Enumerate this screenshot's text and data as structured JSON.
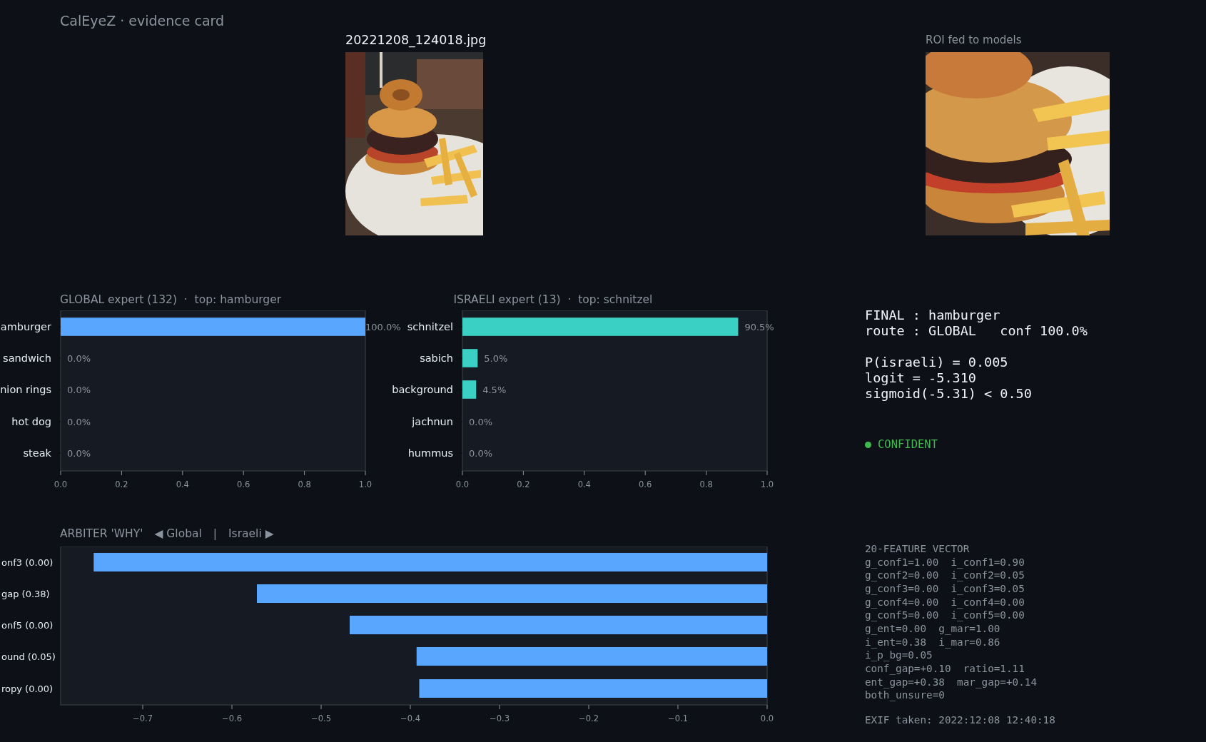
{
  "title": "CalEyeZ · evidence card",
  "photo": {
    "filename": "20221208_124018.jpg"
  },
  "roi": {
    "caption": "ROI fed to models"
  },
  "global_expert": {
    "title": "GLOBAL expert (132)  ·  top: hamburger",
    "chart_data": {
      "type": "bar",
      "orientation": "horizontal",
      "categories": [
        "amburger",
        "sandwich",
        "nion rings",
        "hot dog",
        "steak"
      ],
      "series": [
        {
          "color": "#58a6ff",
          "values": [
            1.0,
            0,
            0,
            0,
            0
          ]
        }
      ],
      "xlim": [
        0,
        1
      ],
      "xticks": [
        {
          "value": 0,
          "label": "0.0"
        },
        {
          "value": 0.2,
          "label": "0.2"
        },
        {
          "value": 0.4,
          "label": "0.4"
        },
        {
          "value": 0.6,
          "label": "0.6"
        },
        {
          "value": 0.8,
          "label": "0.8"
        },
        {
          "value": 1,
          "label": "1.0"
        }
      ],
      "value_labels": [
        "100.0%",
        "0.0%",
        "0.0%",
        "0.0%",
        "0.0%"
      ]
    }
  },
  "israeli_expert": {
    "title": "ISRAELI expert (13)  ·  top: schnitzel",
    "chart_data": {
      "type": "bar",
      "orientation": "horizontal",
      "categories": [
        "schnitzel",
        "sabich",
        "background",
        "jachnun",
        "hummus"
      ],
      "series": [
        {
          "color": "#3bd0c4",
          "values": [
            0.905,
            0.05,
            0.045,
            0,
            0
          ]
        }
      ],
      "xlim": [
        0,
        1
      ],
      "xticks": [
        {
          "value": 0,
          "label": "0.0"
        },
        {
          "value": 0.2,
          "label": "0.2"
        },
        {
          "value": 0.4,
          "label": "0.4"
        },
        {
          "value": 0.6,
          "label": "0.6"
        },
        {
          "value": 0.8,
          "label": "0.8"
        },
        {
          "value": 1,
          "label": "1.0"
        }
      ],
      "value_labels": [
        "90.5%",
        "5.0%",
        "4.5%",
        "0.0%",
        "0.0%"
      ]
    }
  },
  "arbiter": {
    "title": "ARBITER 'WHY'",
    "legend": [
      "◀ Global",
      "|",
      "Israeli ▶"
    ],
    "chart_data": {
      "type": "bar",
      "orientation": "horizontal",
      "categories": [
        "onf3 (0.00)",
        "gap (0.38)",
        "onf5 (0.00)",
        "ound (0.05)",
        "ropy (0.00)"
      ],
      "series": [
        {
          "color": "#58a6ff",
          "values": [
            -0.755,
            -0.572,
            -0.468,
            -0.393,
            -0.39
          ]
        }
      ],
      "xlim": [
        -0.792,
        0
      ],
      "xticks": [
        {
          "value": -0.7,
          "label": "−0.7"
        },
        {
          "value": -0.6,
          "label": "−0.6"
        },
        {
          "value": -0.5,
          "label": "−0.5"
        },
        {
          "value": -0.4,
          "label": "−0.4"
        },
        {
          "value": -0.3,
          "label": "−0.3"
        },
        {
          "value": -0.2,
          "label": "−0.2"
        },
        {
          "value": -0.1,
          "label": "−0.1"
        },
        {
          "value": 0,
          "label": "0.0"
        }
      ]
    }
  },
  "verdict": {
    "blocks": [
      [
        "FINAL : hamburger",
        "route : GLOBAL   conf 100.0%"
      ],
      [
        "P(israeli) = 0.005",
        "logit = -5.310",
        "sigmoid(-5.31) < 0.50"
      ]
    ],
    "status": {
      "kind": "confident",
      "label": "CONFIDENT"
    }
  },
  "features": {
    "title": "20-FEATURE VECTOR",
    "lines": [
      "g_conf1=1.00  i_conf1=0.90",
      "g_conf2=0.00  i_conf2=0.05",
      "g_conf3=0.00  i_conf3=0.05",
      "g_conf4=0.00  i_conf4=0.00",
      "g_conf5=0.00  i_conf5=0.00",
      "g_ent=0.00  g_mar=1.00",
      "i_ent=0.38  i_mar=0.86",
      "i_p_bg=0.05",
      "conf_gap=+0.10  ratio=1.11",
      "ent_gap=+0.38  mar_gap=+0.14",
      "both_unsure=0"
    ],
    "exif": "EXIF taken: 2022:12:08 12:40:18"
  }
}
